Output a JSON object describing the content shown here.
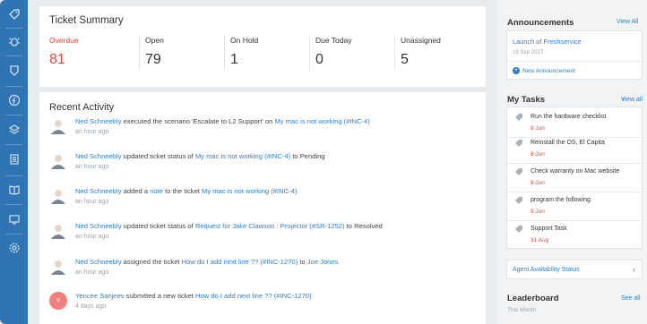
{
  "nav": {
    "icons": [
      "tag-icon",
      "bug-icon",
      "shield-icon",
      "bolt-icon",
      "layers-icon",
      "contacts-icon",
      "book-icon",
      "monitor-icon",
      "gear-icon"
    ]
  },
  "summary": {
    "title": "Ticket Summary",
    "stats": [
      {
        "label": "Overdue",
        "value": "81"
      },
      {
        "label": "Open",
        "value": "79"
      },
      {
        "label": "On Hold",
        "value": "1"
      },
      {
        "label": "Due Today",
        "value": "0"
      },
      {
        "label": "Unassigned",
        "value": "5"
      }
    ]
  },
  "activity": {
    "title": "Recent Activity",
    "items": [
      {
        "actor": "Ned Schneebly",
        "text1": " executed the scenario 'Escalate to L2 Support' on ",
        "link1": "My mac is not working (#INC-4)",
        "text2": "",
        "link2": "",
        "time": "an hour ago"
      },
      {
        "actor": "Ned Schneebly",
        "text1": " updated ticket status of ",
        "link1": "My mac is not working (#INC-4)",
        "text2": " to Pending",
        "link2": "",
        "time": "an hour ago"
      },
      {
        "actor": "Ned Schneebly",
        "text1": " added a ",
        "link1": "note",
        "text2": " to the ticket ",
        "link2": "My mac is not working (#INC-4)",
        "time": "an hour ago"
      },
      {
        "actor": "Ned Schneebly",
        "text1": " updated ticket status of ",
        "link1": "Request for Jake Clawson : Projector (#SR-1252)",
        "text2": " to Resolved",
        "link2": "",
        "time": "an hour ago"
      },
      {
        "actor": "Ned Schneebly",
        "text1": " assigned the ticket ",
        "link1": "How do I add next line ?? (#INC-1270)",
        "text2": " to ",
        "link2": "Joe Jones",
        "time": "an hour ago"
      },
      {
        "actor": "Yencee Sanjeev",
        "text1": " submitted a new ticket ",
        "link1": "How do I add next line ?? (#INC-1270)",
        "text2": "",
        "link2": "",
        "time": "4 days ago",
        "initial": "Y"
      }
    ]
  },
  "announcements": {
    "title": "Announcements",
    "view_all": "View All",
    "item_title": "Launch of Freshservice",
    "item_date": "19 Sep 2017",
    "new_label": "New Announcement"
  },
  "tasks": {
    "title": "My Tasks",
    "view_all": "View all",
    "items": [
      {
        "name": "Run the hardware checklist",
        "date": "8 Jun"
      },
      {
        "name": "Reinstall the OS, El Capita",
        "date": "8 Jun"
      },
      {
        "name": "Check warranty on Mac website",
        "date": "8 Jun"
      },
      {
        "name": "program the following",
        "date": "9 Jun"
      },
      {
        "name": "Support Task",
        "date": "31 Aug"
      }
    ]
  },
  "agent_status": {
    "label": "Agent Availability Status"
  },
  "leaderboard": {
    "title": "Leaderboard",
    "view_all": "See all",
    "sub": "This Month"
  },
  "colors": {
    "nav": "#2f74b3",
    "link": "#2f7fc8",
    "overdue": "#e5443a"
  }
}
